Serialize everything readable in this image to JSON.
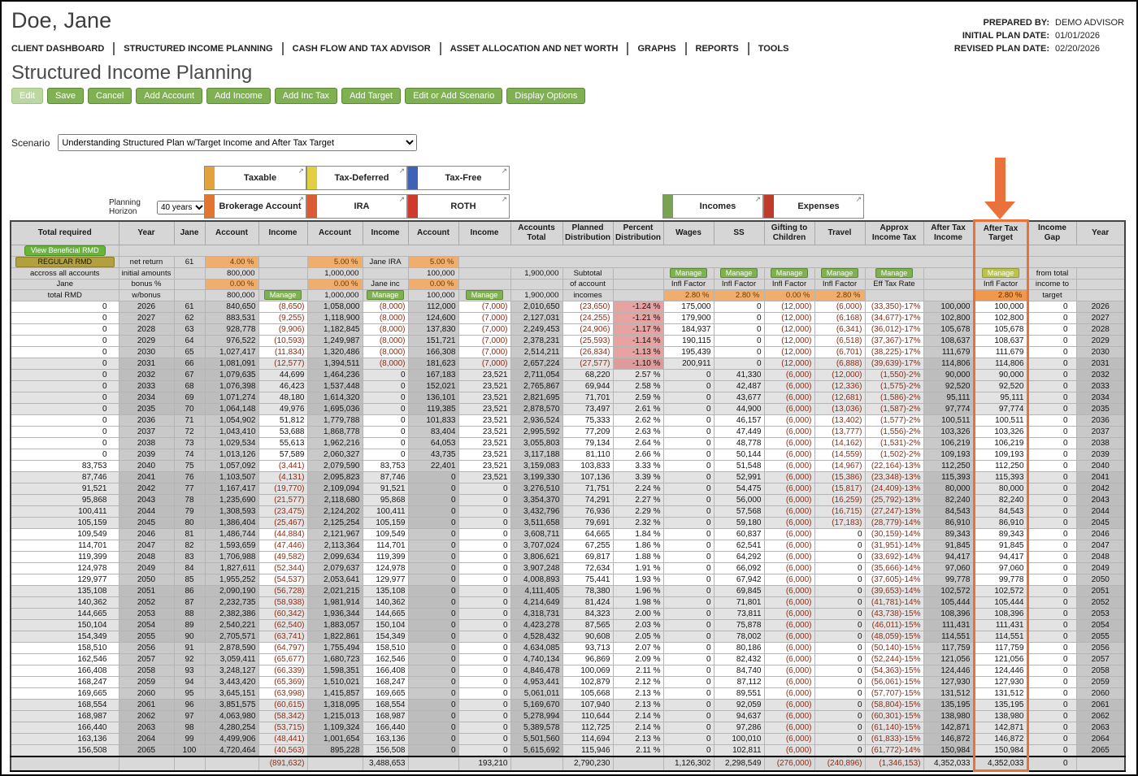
{
  "client_name": "Doe, Jane",
  "meta": {
    "prepared_by_label": "PREPARED BY:",
    "prepared_by": "DEMO ADVISOR",
    "initial_plan_date_label": "INITIAL PLAN DATE:",
    "initial_plan_date": "01/01/2026",
    "revised_plan_date_label": "REVISED PLAN DATE:",
    "revised_plan_date": "02/20/2026"
  },
  "nav": {
    "items": [
      "CLIENT DASHBOARD",
      "STRUCTURED INCOME PLANNING",
      "CASH FLOW AND TAX ADVISOR",
      "ASSET ALLOCATION AND NET WORTH",
      "GRAPHS",
      "REPORTS",
      "TOOLS"
    ]
  },
  "page_title": "Structured Income Planning",
  "toolbar": {
    "edit": "Edit",
    "save": "Save",
    "cancel": "Cancel",
    "add_account": "Add Account",
    "add_income": "Add Income",
    "add_inc_tax": "Add Inc Tax",
    "add_target": "Add Target",
    "edit_or_add_scenario": "Edit or Add Scenario",
    "display_options": "Display Options"
  },
  "scenario": {
    "label": "Scenario",
    "selected": "Understanding Structured Plan w/Target Income and After Tax Target"
  },
  "planning_horizon": {
    "label": "Planning Horizon",
    "value": "40 years"
  },
  "account_groups": {
    "taxable": {
      "label": "Taxable",
      "bar_color": "#e2a33d"
    },
    "tax_deferred": {
      "label": "Tax-Deferred",
      "bar_color": "#e3cf43"
    },
    "tax_free": {
      "label": "Tax-Free",
      "bar_color": "#3f62b5"
    },
    "brokerage": {
      "label": "Brokerage Account",
      "bar_color": "#e2762f"
    },
    "ira": {
      "label": "IRA",
      "bar_color": "#dc5b35"
    },
    "roth": {
      "label": "ROTH",
      "bar_color": "#cf3a2d"
    },
    "incomes": {
      "label": "Incomes",
      "bar_color": "#79a352"
    },
    "expenses": {
      "label": "Expenses",
      "bar_color": "#bf3a2b"
    }
  },
  "annotation": {
    "arrow_color": "#e8713c",
    "highlighted_column": "After Tax Target"
  },
  "table": {
    "headers": [
      "Total required",
      "Year",
      "Jane",
      "Account",
      "Income",
      "Account",
      "Income",
      "Account",
      "Income",
      "Accounts Total",
      "Planned Distribution",
      "Percent Distribution",
      "Wages",
      "SS",
      "Gifting to Children",
      "Travel",
      "Approx Income Tax",
      "After Tax Income",
      "After Tax Target",
      "Income Gap",
      "Year"
    ],
    "subheader": {
      "view_beneficial_rmd": "View Beneficial RMD",
      "regular_rmd": "REGULAR RMD",
      "across_all_accounts": "accross all accounts",
      "jane_label": "Jane",
      "total_rmd": "total RMD",
      "net_return_label": "net return",
      "initial_amounts_label": "initial amounts",
      "bonus_label": "bonus %",
      "w_bonus_label": "w/bonus",
      "jane_age": "61",
      "brokerage": {
        "net_return": "4.00 %",
        "initial": "800,000",
        "bonus": "0.00 %",
        "w_bonus": "800,000"
      },
      "ira": {
        "net_return": "5.00 %",
        "name": "Jane IRA",
        "initial": "1,000,000",
        "bonus": "0.00 %",
        "income_name": "Jane inc",
        "w_bonus": "1,000,000"
      },
      "roth": {
        "net_return": "5.00 %",
        "initial": "100,000",
        "bonus": "0.00 %",
        "w_bonus": "100,000"
      },
      "accounts_total_initial": "1,900,000",
      "accounts_total_w_bonus": "1,900,000",
      "subtotal_label": "Subtotal",
      "of_account_label": "of account",
      "incomes_label": "incomes",
      "manage_label": "Manage",
      "infl_factor_label": "Infl Factor",
      "eff_tax_rate_label": "Eff Tax Rate",
      "wages_infl": "2.80 %",
      "ss_infl": "2.80 %",
      "gifting_infl": "0.00 %",
      "travel_infl": "2.80 %",
      "after_tax_target_infl": "2.80 %",
      "income_gap_note_1": "from total",
      "income_gap_note_2": "income to",
      "income_gap_note_3": "target"
    },
    "rows": [
      [
        "0",
        "2026",
        "61",
        "840,650",
        "(8,650)",
        "1,058,000",
        "(8,000)",
        "112,000",
        "(7,000)",
        "2,010,650",
        "(23,650)",
        "-1.24 %",
        "175,000",
        "0",
        "(12,000)",
        "(6,000)",
        "(33,350)-17%",
        "100,000",
        "100,000",
        "0",
        "2026"
      ],
      [
        "0",
        "2027",
        "62",
        "883,531",
        "(9,255)",
        "1,118,900",
        "(8,000)",
        "124,600",
        "(7,000)",
        "2,127,031",
        "(24,255)",
        "-1.21 %",
        "179,900",
        "0",
        "(12,000)",
        "(6,168)",
        "(34,677)-17%",
        "102,800",
        "102,800",
        "0",
        "2027"
      ],
      [
        "0",
        "2028",
        "63",
        "928,778",
        "(9,906)",
        "1,182,845",
        "(8,000)",
        "137,830",
        "(7,000)",
        "2,249,453",
        "(24,906)",
        "-1.17 %",
        "184,937",
        "0",
        "(12,000)",
        "(6,341)",
        "(36,012)-17%",
        "105,678",
        "105,678",
        "0",
        "2028"
      ],
      [
        "0",
        "2029",
        "64",
        "976,522",
        "(10,593)",
        "1,249,987",
        "(8,000)",
        "151,721",
        "(7,000)",
        "2,378,231",
        "(25,593)",
        "-1.14 %",
        "190,115",
        "0",
        "(12,000)",
        "(6,518)",
        "(37,367)-17%",
        "108,637",
        "108,637",
        "0",
        "2029"
      ],
      [
        "0",
        "2030",
        "65",
        "1,027,417",
        "(11,834)",
        "1,320,486",
        "(8,000)",
        "166,308",
        "(7,000)",
        "2,514,211",
        "(26,834)",
        "-1.13 %",
        "195,439",
        "0",
        "(12,000)",
        "(6,701)",
        "(38,225)-17%",
        "111,679",
        "111,679",
        "0",
        "2030"
      ],
      [
        "0",
        "2031",
        "66",
        "1,081,091",
        "(12,577)",
        "1,394,511",
        "(8,000)",
        "181,623",
        "(7,000)",
        "2,657,224",
        "(27,577)",
        "-1.10 %",
        "200,911",
        "0",
        "(12,000)",
        "(6,888)",
        "(39,639)-17%",
        "114,806",
        "114,806",
        "0",
        "2031"
      ],
      [
        "0",
        "2032",
        "67",
        "1,079,635",
        "44,699",
        "1,464,236",
        "0",
        "167,183",
        "23,521",
        "2,711,054",
        "68,220",
        "2.57 %",
        "0",
        "41,330",
        "(6,000)",
        "(12,000)",
        "(1,550)-2%",
        "90,000",
        "90,000",
        "0",
        "2032"
      ],
      [
        "0",
        "2033",
        "68",
        "1,076,398",
        "46,423",
        "1,537,448",
        "0",
        "152,021",
        "23,521",
        "2,765,867",
        "69,944",
        "2.58 %",
        "0",
        "42,487",
        "(6,000)",
        "(12,336)",
        "(1,575)-2%",
        "92,520",
        "92,520",
        "0",
        "2033"
      ],
      [
        "0",
        "2034",
        "69",
        "1,071,274",
        "48,180",
        "1,614,320",
        "0",
        "136,101",
        "23,521",
        "2,821,695",
        "71,701",
        "2.59 %",
        "0",
        "43,677",
        "(6,000)",
        "(12,681)",
        "(1,586)-2%",
        "95,111",
        "95,111",
        "0",
        "2034"
      ],
      [
        "0",
        "2035",
        "70",
        "1,064,148",
        "49,976",
        "1,695,036",
        "0",
        "119,385",
        "23,521",
        "2,878,570",
        "73,497",
        "2.61 %",
        "0",
        "44,900",
        "(6,000)",
        "(13,036)",
        "(1,587)-2%",
        "97,774",
        "97,774",
        "0",
        "2035"
      ],
      [
        "0",
        "2036",
        "71",
        "1,054,902",
        "51,812",
        "1,779,788",
        "0",
        "101,833",
        "23,521",
        "2,936,524",
        "75,333",
        "2.62 %",
        "0",
        "46,157",
        "(6,000)",
        "(13,402)",
        "(1,577)-2%",
        "100,511",
        "100,511",
        "0",
        "2036"
      ],
      [
        "0",
        "2037",
        "72",
        "1,043,410",
        "53,688",
        "1,868,778",
        "0",
        "83,404",
        "23,521",
        "2,995,592",
        "77,209",
        "2.63 %",
        "0",
        "47,449",
        "(6,000)",
        "(13,777)",
        "(1,556)-2%",
        "103,326",
        "103,326",
        "0",
        "2037"
      ],
      [
        "0",
        "2038",
        "73",
        "1,029,534",
        "55,613",
        "1,962,216",
        "0",
        "64,053",
        "23,521",
        "3,055,803",
        "79,134",
        "2.64 %",
        "0",
        "48,778",
        "(6,000)",
        "(14,162)",
        "(1,531)-2%",
        "106,219",
        "106,219",
        "0",
        "2038"
      ],
      [
        "0",
        "2039",
        "74",
        "1,013,126",
        "57,589",
        "2,060,327",
        "0",
        "43,735",
        "23,521",
        "3,117,188",
        "81,110",
        "2.66 %",
        "0",
        "50,144",
        "(6,000)",
        "(14,559)",
        "(1,502)-2%",
        "109,193",
        "109,193",
        "0",
        "2039"
      ],
      [
        "83,753",
        "2040",
        "75",
        "1,057,092",
        "(3,441)",
        "2,079,590",
        "83,753",
        "22,401",
        "23,521",
        "3,159,083",
        "103,833",
        "3.33 %",
        "0",
        "51,548",
        "(6,000)",
        "(14,967)",
        "(22,164)-13%",
        "112,250",
        "112,250",
        "0",
        "2040"
      ],
      [
        "87,746",
        "2041",
        "76",
        "1,103,507",
        "(4,131)",
        "2,095,823",
        "87,746",
        "0",
        "23,521",
        "3,199,330",
        "107,136",
        "3.39 %",
        "0",
        "52,991",
        "(6,000)",
        "(15,386)",
        "(23,348)-13%",
        "115,393",
        "115,393",
        "0",
        "2041"
      ],
      [
        "91,521",
        "2042",
        "77",
        "1,167,417",
        "(19,770)",
        "2,109,094",
        "91,521",
        "0",
        "0",
        "3,276,510",
        "71,751",
        "2.24 %",
        "0",
        "54,475",
        "(6,000)",
        "(15,817)",
        "(24,409)-13%",
        "80,000",
        "80,000",
        "0",
        "2042"
      ],
      [
        "95,868",
        "2043",
        "78",
        "1,235,690",
        "(21,577)",
        "2,118,680",
        "95,868",
        "0",
        "0",
        "3,354,370",
        "74,291",
        "2.27 %",
        "0",
        "56,000",
        "(6,000)",
        "(16,259)",
        "(25,792)-13%",
        "82,240",
        "82,240",
        "0",
        "2043"
      ],
      [
        "100,411",
        "2044",
        "79",
        "1,308,593",
        "(23,475)",
        "2,124,202",
        "100,411",
        "0",
        "0",
        "3,432,796",
        "76,936",
        "2.29 %",
        "0",
        "57,568",
        "(6,000)",
        "(16,715)",
        "(27,247)-13%",
        "84,543",
        "84,543",
        "0",
        "2044"
      ],
      [
        "105,159",
        "2045",
        "80",
        "1,386,404",
        "(25,467)",
        "2,125,254",
        "105,159",
        "0",
        "0",
        "3,511,658",
        "79,691",
        "2.32 %",
        "0",
        "59,180",
        "(6,000)",
        "(17,183)",
        "(28,779)-14%",
        "86,910",
        "86,910",
        "0",
        "2045"
      ],
      [
        "109,549",
        "2046",
        "81",
        "1,486,744",
        "(44,884)",
        "2,121,967",
        "109,549",
        "0",
        "0",
        "3,608,711",
        "64,665",
        "1.84 %",
        "0",
        "60,837",
        "(6,000)",
        "0",
        "(30,159)-14%",
        "89,343",
        "89,343",
        "0",
        "2046"
      ],
      [
        "114,701",
        "2047",
        "82",
        "1,593,659",
        "(47,446)",
        "2,113,364",
        "114,701",
        "0",
        "0",
        "3,707,024",
        "67,255",
        "1.86 %",
        "0",
        "62,541",
        "(6,000)",
        "0",
        "(31,951)-14%",
        "91,845",
        "91,845",
        "0",
        "2047"
      ],
      [
        "119,399",
        "2048",
        "83",
        "1,706,988",
        "(49,582)",
        "2,099,634",
        "119,399",
        "0",
        "0",
        "3,806,621",
        "69,817",
        "1.88 %",
        "0",
        "64,292",
        "(6,000)",
        "0",
        "(33,692)-14%",
        "94,417",
        "94,417",
        "0",
        "2048"
      ],
      [
        "124,978",
        "2049",
        "84",
        "1,827,611",
        "(52,344)",
        "2,079,637",
        "124,978",
        "0",
        "0",
        "3,907,248",
        "72,634",
        "1.91 %",
        "0",
        "66,092",
        "(6,000)",
        "0",
        "(35,666)-14%",
        "97,060",
        "97,060",
        "0",
        "2049"
      ],
      [
        "129,977",
        "2050",
        "85",
        "1,955,252",
        "(54,537)",
        "2,053,641",
        "129,977",
        "0",
        "0",
        "4,008,893",
        "75,441",
        "1.93 %",
        "0",
        "67,942",
        "(6,000)",
        "0",
        "(37,605)-14%",
        "99,778",
        "99,778",
        "0",
        "2050"
      ],
      [
        "135,108",
        "2051",
        "86",
        "2,090,190",
        "(56,728)",
        "2,021,215",
        "135,108",
        "0",
        "0",
        "4,111,405",
        "78,380",
        "1.96 %",
        "0",
        "69,845",
        "(6,000)",
        "0",
        "(39,653)-14%",
        "102,572",
        "102,572",
        "0",
        "2051"
      ],
      [
        "140,362",
        "2052",
        "87",
        "2,232,735",
        "(58,938)",
        "1,981,914",
        "140,362",
        "0",
        "0",
        "4,214,649",
        "81,424",
        "1.98 %",
        "0",
        "71,801",
        "(6,000)",
        "0",
        "(41,781)-14%",
        "105,444",
        "105,444",
        "0",
        "2052"
      ],
      [
        "144,665",
        "2053",
        "88",
        "2,382,386",
        "(60,342)",
        "1,936,344",
        "144,665",
        "0",
        "0",
        "4,318,731",
        "84,323",
        "2.00 %",
        "0",
        "73,811",
        "(6,000)",
        "0",
        "(43,738)-15%",
        "108,396",
        "108,396",
        "0",
        "2053"
      ],
      [
        "150,104",
        "2054",
        "89",
        "2,540,221",
        "(62,540)",
        "1,883,057",
        "150,104",
        "0",
        "0",
        "4,423,278",
        "87,565",
        "2.03 %",
        "0",
        "75,878",
        "(6,000)",
        "0",
        "(46,011)-15%",
        "111,431",
        "111,431",
        "0",
        "2054"
      ],
      [
        "154,349",
        "2055",
        "90",
        "2,705,571",
        "(63,741)",
        "1,822,861",
        "154,349",
        "0",
        "0",
        "4,528,432",
        "90,608",
        "2.05 %",
        "0",
        "78,002",
        "(6,000)",
        "0",
        "(48,059)-15%",
        "114,551",
        "114,551",
        "0",
        "2055"
      ],
      [
        "158,510",
        "2056",
        "91",
        "2,878,590",
        "(64,797)",
        "1,755,494",
        "158,510",
        "0",
        "0",
        "4,634,085",
        "93,713",
        "2.07 %",
        "0",
        "80,186",
        "(6,000)",
        "0",
        "(50,140)-15%",
        "117,759",
        "117,759",
        "0",
        "2056"
      ],
      [
        "162,546",
        "2057",
        "92",
        "3,059,411",
        "(65,677)",
        "1,680,723",
        "162,546",
        "0",
        "0",
        "4,740,134",
        "96,869",
        "2.09 %",
        "0",
        "82,432",
        "(6,000)",
        "0",
        "(52,244)-15%",
        "121,056",
        "121,056",
        "0",
        "2057"
      ],
      [
        "166,408",
        "2058",
        "93",
        "3,248,127",
        "(66,339)",
        "1,598,351",
        "166,408",
        "0",
        "0",
        "4,846,478",
        "100,069",
        "2.11 %",
        "0",
        "84,740",
        "(6,000)",
        "0",
        "(54,363)-15%",
        "124,446",
        "124,446",
        "0",
        "2058"
      ],
      [
        "168,247",
        "2059",
        "94",
        "3,443,420",
        "(65,369)",
        "1,510,021",
        "168,247",
        "0",
        "0",
        "4,953,441",
        "102,879",
        "2.12 %",
        "0",
        "87,112",
        "(6,000)",
        "0",
        "(56,061)-15%",
        "127,930",
        "127,930",
        "0",
        "2059"
      ],
      [
        "169,665",
        "2060",
        "95",
        "3,645,151",
        "(63,998)",
        "1,415,857",
        "169,665",
        "0",
        "0",
        "5,061,011",
        "105,668",
        "2.13 %",
        "0",
        "89,551",
        "(6,000)",
        "0",
        "(57,707)-15%",
        "131,512",
        "131,512",
        "0",
        "2060"
      ],
      [
        "168,554",
        "2061",
        "96",
        "3,851,575",
        "(60,615)",
        "1,318,095",
        "168,554",
        "0",
        "0",
        "5,169,670",
        "107,940",
        "2.13 %",
        "0",
        "92,059",
        "(6,000)",
        "0",
        "(58,804)-15%",
        "135,195",
        "135,195",
        "0",
        "2061"
      ],
      [
        "168,987",
        "2062",
        "97",
        "4,063,980",
        "(58,342)",
        "1,215,013",
        "168,987",
        "0",
        "0",
        "5,278,994",
        "110,644",
        "2.14 %",
        "0",
        "94,637",
        "(6,000)",
        "0",
        "(60,301)-15%",
        "138,980",
        "138,980",
        "0",
        "2062"
      ],
      [
        "166,440",
        "2063",
        "98",
        "4,280,254",
        "(53,715)",
        "1,109,324",
        "166,440",
        "0",
        "0",
        "5,389,578",
        "112,725",
        "2.14 %",
        "0",
        "97,286",
        "(6,000)",
        "0",
        "(61,140)-15%",
        "142,871",
        "142,871",
        "0",
        "2063"
      ],
      [
        "163,136",
        "2064",
        "99",
        "4,499,906",
        "(48,441)",
        "1,001,654",
        "163,136",
        "0",
        "0",
        "5,501,560",
        "114,694",
        "2.13 %",
        "0",
        "100,010",
        "(6,000)",
        "0",
        "(61,833)-15%",
        "146,872",
        "146,872",
        "0",
        "2064"
      ],
      [
        "156,508",
        "2065",
        "100",
        "4,720,464",
        "(40,563)",
        "895,228",
        "156,508",
        "0",
        "0",
        "5,615,692",
        "115,946",
        "2.11 %",
        "0",
        "102,811",
        "(6,000)",
        "0",
        "(61,772)-14%",
        "150,984",
        "150,984",
        "0",
        "2065"
      ]
    ],
    "totals": [
      "",
      "",
      "",
      "",
      "(891,632)",
      "",
      "3,488,653",
      "",
      "193,210",
      "",
      "2,790,230",
      "",
      "1,126,302",
      "2,298,549",
      "(276,000)",
      "(240,896)",
      "(1,346,153)",
      "4,352,033",
      "4,352,033",
      "0",
      ""
    ]
  }
}
